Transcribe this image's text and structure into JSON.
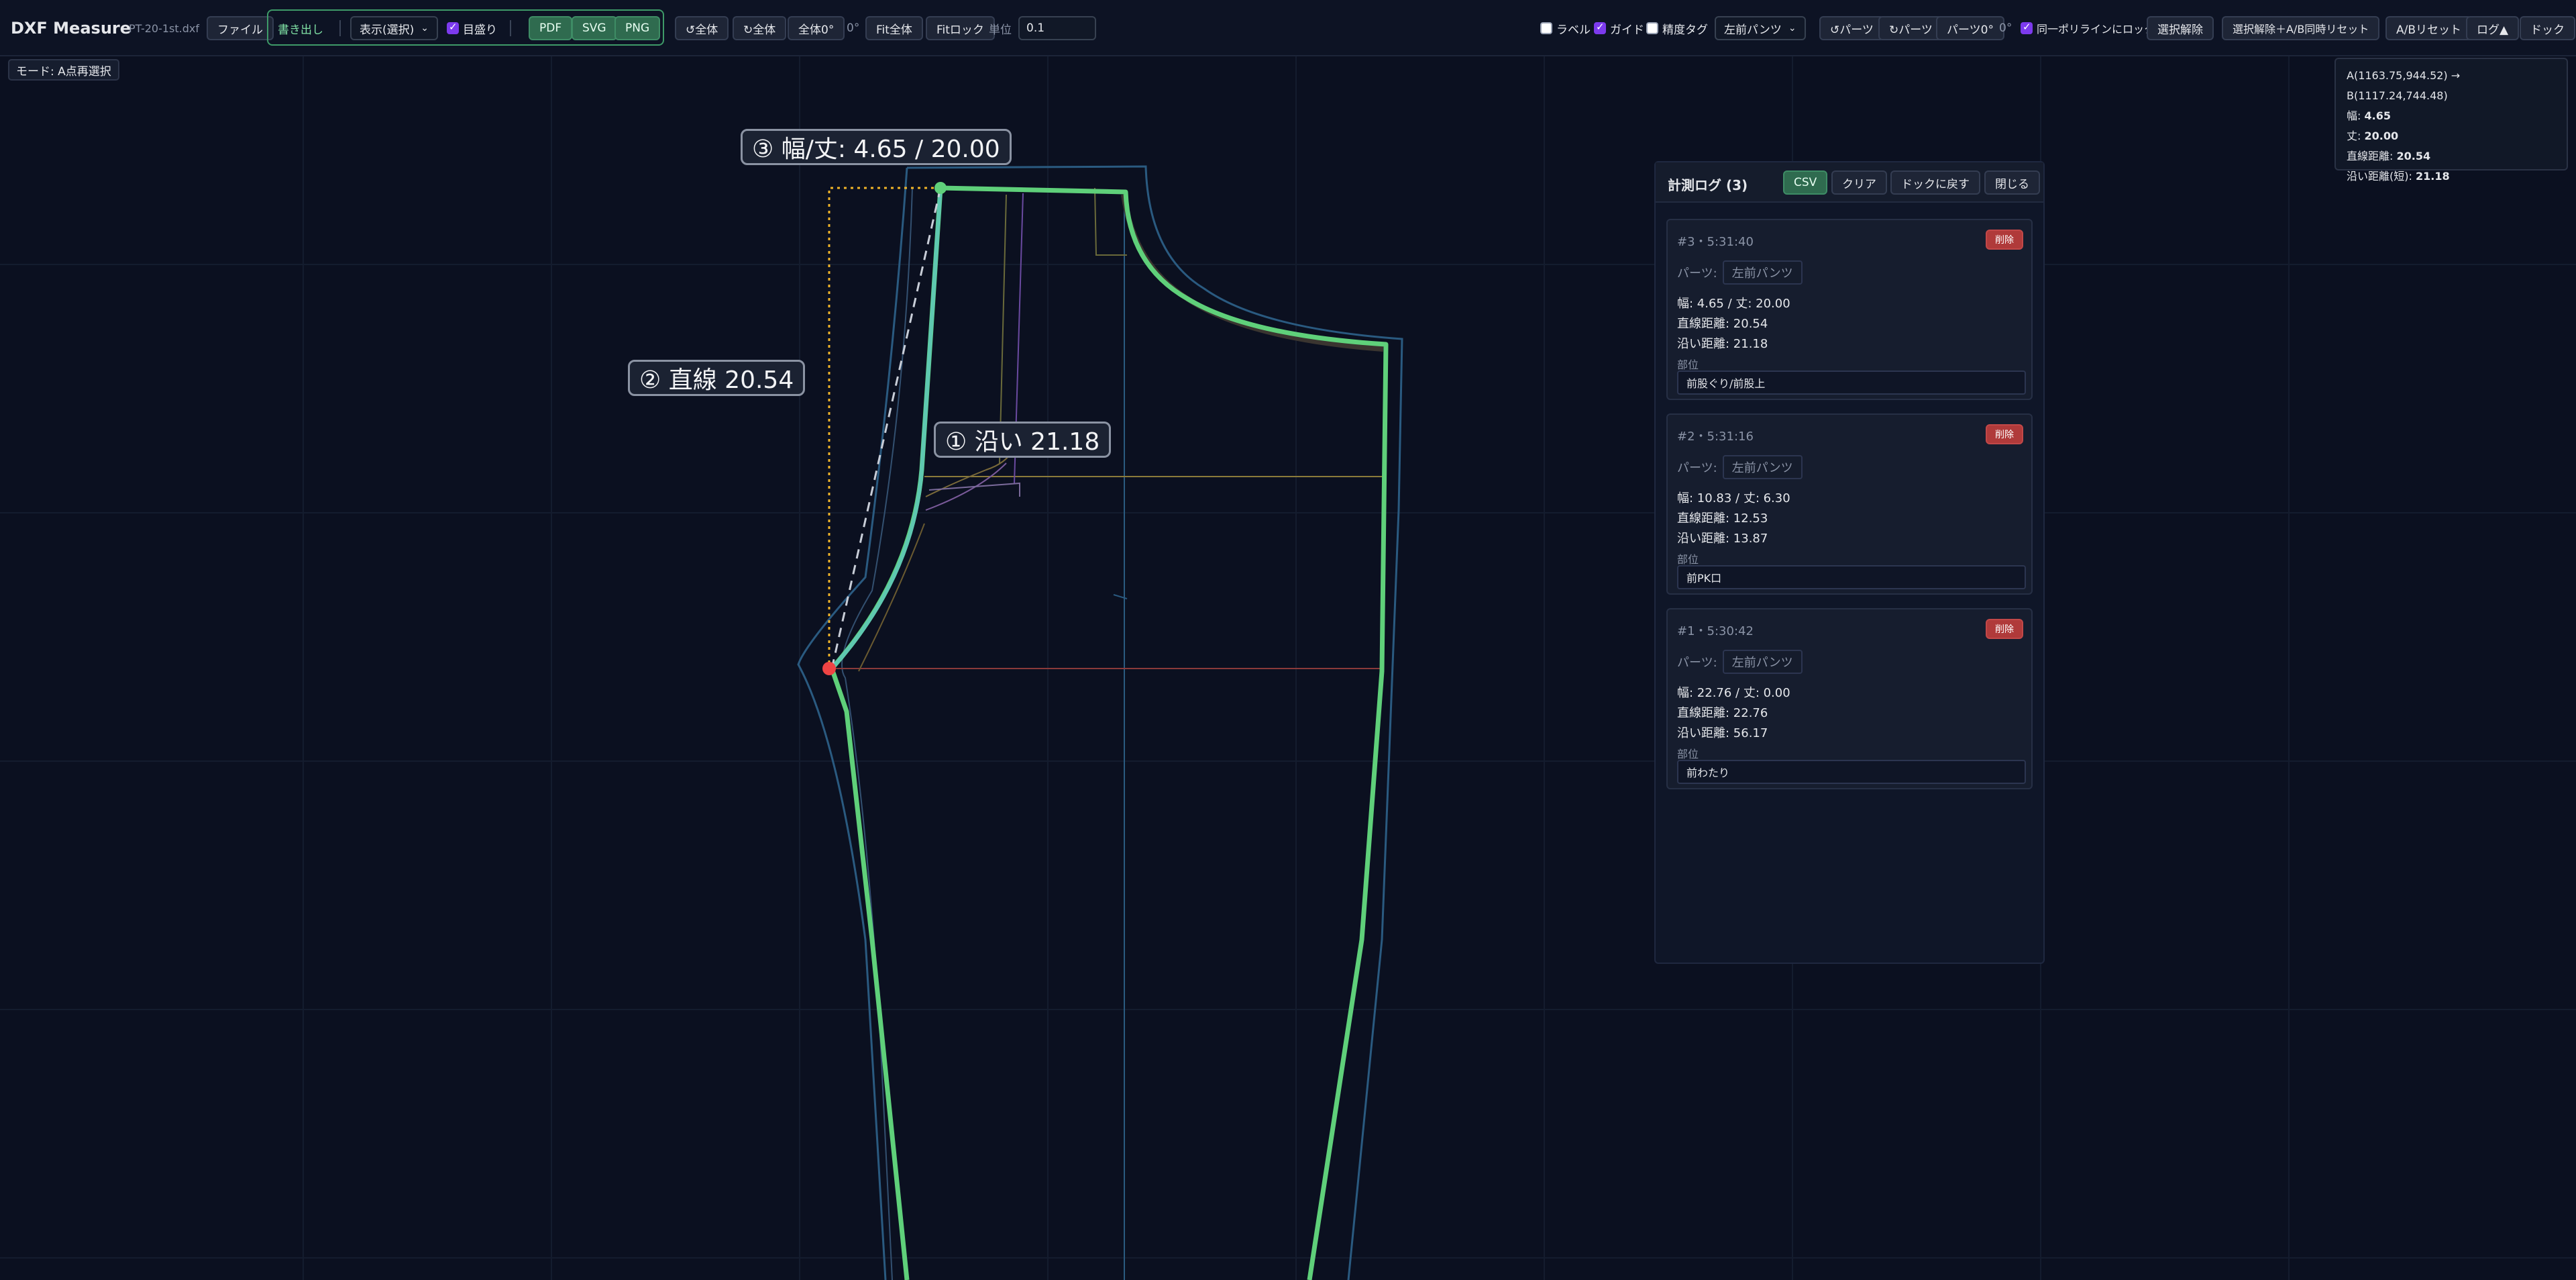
{
  "app": {
    "title": "DXF Measure",
    "filename": "PT-20-1st.dxf",
    "file_button": "ファイル"
  },
  "export_group": {
    "label": "書き出し",
    "display_select": "表示(選択)",
    "ruler_label": "目盛り",
    "ruler_checked": true,
    "pdf": "PDF",
    "svg": "SVG",
    "png": "PNG"
  },
  "view_controls": {
    "rotate_ccw_all": "↺全体",
    "rotate_cw_all": "↻全体",
    "all_zero": "全体0°",
    "angle": "0°",
    "fit_all": "Fit全体",
    "fit_lock": "Fitロック",
    "unit_label": "単位",
    "unit_value": "0.1"
  },
  "right_controls": {
    "label_toggle": "ラベル",
    "label_checked": false,
    "guide_toggle": "ガイド",
    "guide_checked": true,
    "precision_tag": "精度タグ",
    "precision_checked": false,
    "part_select": "左前パンツ",
    "rotate_ccw_part": "↺パーツ",
    "rotate_cw_part": "↻パーツ",
    "part_zero": "パーツ0°",
    "part_angle": "0°",
    "same_polyline_lock": "同一ポリラインにロック",
    "same_polyline_checked": true,
    "deselect": "選択解除",
    "deselect_ab_reset": "選択解除＋A/B同時リセット",
    "ab_reset": "A/Bリセット",
    "log_toggle": "ログ▲",
    "dock": "ドック"
  },
  "mode": "モード: A点再選択",
  "info": {
    "coords": "A(1163.75,944.52) → B(1117.24,744.48)",
    "width_label": "幅",
    "width": "4.65",
    "height_label": "丈",
    "height": "20.00",
    "straight_label": "直線距離",
    "straight": "20.54",
    "along_label": "沿い距離(短)",
    "along": "21.18"
  },
  "canvas_tags": {
    "tag1": "① 沿い 21.18",
    "tag2": "② 直線 20.54",
    "tag3": "③ 幅/丈: 4.65 / 20.00"
  },
  "log": {
    "title": "計測ログ (3)",
    "csv": "CSV",
    "clear": "クリア",
    "back_to_dock": "ドックに戻す",
    "close": "閉じる",
    "parts_label": "パーツ:",
    "part_name": "左前パンツ",
    "section_label": "部位",
    "delete": "削除",
    "entries": [
      {
        "header": "#3・5:31:40",
        "wh": "幅: 4.65 / 丈: 20.00",
        "straight": "直線距離: 20.54",
        "along": "沿い距離: 21.18",
        "section": "前股ぐり/前股上"
      },
      {
        "header": "#2・5:31:16",
        "wh": "幅: 10.83 / 丈: 6.30",
        "straight": "直線距離: 12.53",
        "along": "沿い距離: 13.87",
        "section": "前PK口"
      },
      {
        "header": "#1・5:30:42",
        "wh": "幅: 22.76 / 丈: 0.00",
        "straight": "直線距離: 22.76",
        "along": "沿い距離: 56.17",
        "section": "前わたり"
      }
    ]
  },
  "colors": {
    "background": "#0b1020",
    "accent_green": "#5fd07a",
    "measure_cyan": "#5ec8b0",
    "point_a": "#ef4444",
    "guide_orange": "#f0b429",
    "pattern_blue": "#2a5a80",
    "delete_red": "#b03a3a"
  }
}
